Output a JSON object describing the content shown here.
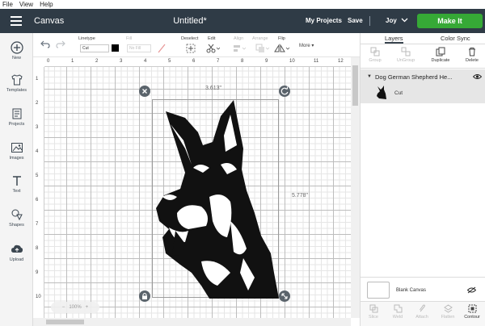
{
  "menu": [
    "File",
    "View",
    "Help"
  ],
  "header": {
    "app_title": "Canvas",
    "doc_title": "Untitled*",
    "my_projects": "My Projects",
    "save": "Save",
    "user": "Joy",
    "make_it": "Make It",
    "accent": "#36a936"
  },
  "sidebar": {
    "items": [
      {
        "label": "New",
        "icon": "plus-icon"
      },
      {
        "label": "Templates",
        "icon": "shirt-icon"
      },
      {
        "label": "Projects",
        "icon": "projects-icon"
      },
      {
        "label": "Images",
        "icon": "image-icon"
      },
      {
        "label": "Text",
        "icon": "text-icon"
      },
      {
        "label": "Shapes",
        "icon": "shapes-icon"
      },
      {
        "label": "Upload",
        "icon": "upload-icon"
      }
    ]
  },
  "toolbar": {
    "linetype_label": "Linetype",
    "linetype_value": "Cut",
    "fill_label": "Fill",
    "fill_value": "No Fill",
    "deselect": "Deselect",
    "edit": "Edit",
    "align": "Align",
    "arrange": "Arrange",
    "flip": "Flip",
    "more": "More ▾"
  },
  "canvas": {
    "ruler_top": [
      "0",
      "1",
      "2",
      "3",
      "4",
      "5",
      "6",
      "7",
      "8",
      "9",
      "10",
      "11",
      "12"
    ],
    "ruler_left": [
      "1",
      "2",
      "3",
      "4",
      "5",
      "6",
      "7",
      "8",
      "9",
      "10"
    ],
    "width_label": "3.613\"",
    "height_label": "5.778\"",
    "zoom": "100%"
  },
  "panel": {
    "tabs": [
      "Layers",
      "Color Sync"
    ],
    "actions": [
      "Group",
      "UnGroup",
      "Duplicate",
      "Delete"
    ],
    "layer_title": "Dog German Shepherd He...",
    "layer_item": "Cut",
    "blank_canvas": "Blank Canvas",
    "bottom_actions": [
      "Slice",
      "Weld",
      "Attach",
      "Flatten",
      "Contour"
    ]
  }
}
